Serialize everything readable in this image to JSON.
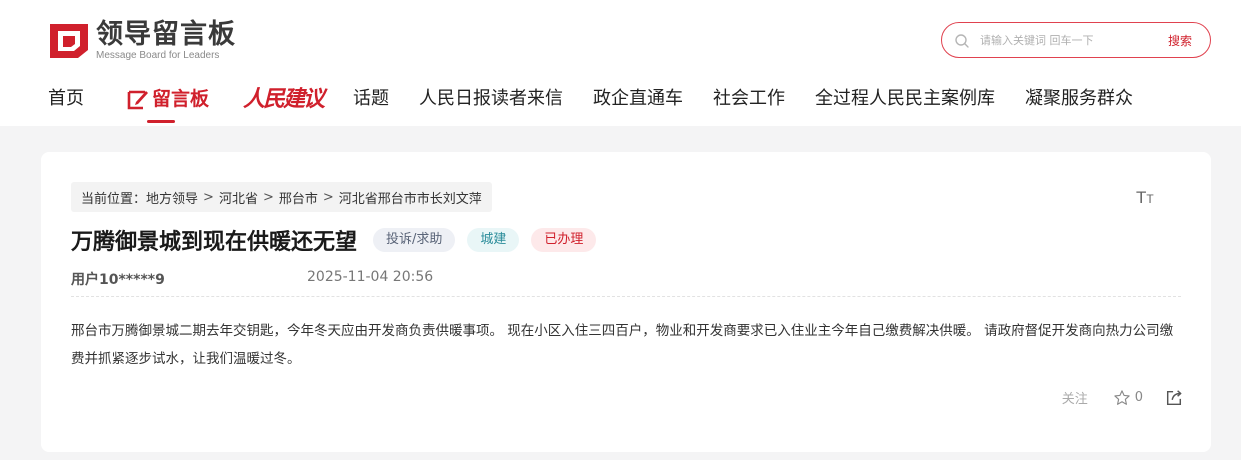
{
  "header": {
    "logo_title": "领导留言板",
    "logo_subtitle": "Message Board for Leaders",
    "search": {
      "placeholder": "请输入关键词 回车一下",
      "button": "搜索"
    }
  },
  "nav": {
    "items": [
      "首页",
      "留言板",
      "人民建议",
      "话题",
      "人民日报读者来信",
      "政企直通车",
      "社会工作",
      "全过程人民民主案例库",
      "凝聚服务群众"
    ],
    "active": "留言板"
  },
  "breadcrumb": {
    "prefix": "当前位置：",
    "items": [
      "地方领导",
      "河北省",
      "邢台市",
      "河北省邢台市市长刘文萍"
    ],
    "separator": ">"
  },
  "font_toggle": {
    "big": "T",
    "small": "T"
  },
  "post": {
    "title": "万腾御景城到现在供暖还无望",
    "tags": {
      "type": "投诉/求助",
      "field": "城建",
      "status": "已办理"
    },
    "user": "用户10*****9",
    "time": "2025-11-04 20:56",
    "content": "邢台市万腾御景城二期去年交钥匙，今年冬天应由开发商负责供暖事项。 现在小区入住三四百户，物业和开发商要求已入住业主今年自己缴费解决供暖。 请政府督促开发商向热力公司缴费并抓紧逐步试水，让我们温暖过冬。"
  },
  "actions": {
    "follow": "关注",
    "likes": "0"
  },
  "colors": {
    "brand_red": "#d0202c",
    "page_bg": "#f4f4f5"
  }
}
